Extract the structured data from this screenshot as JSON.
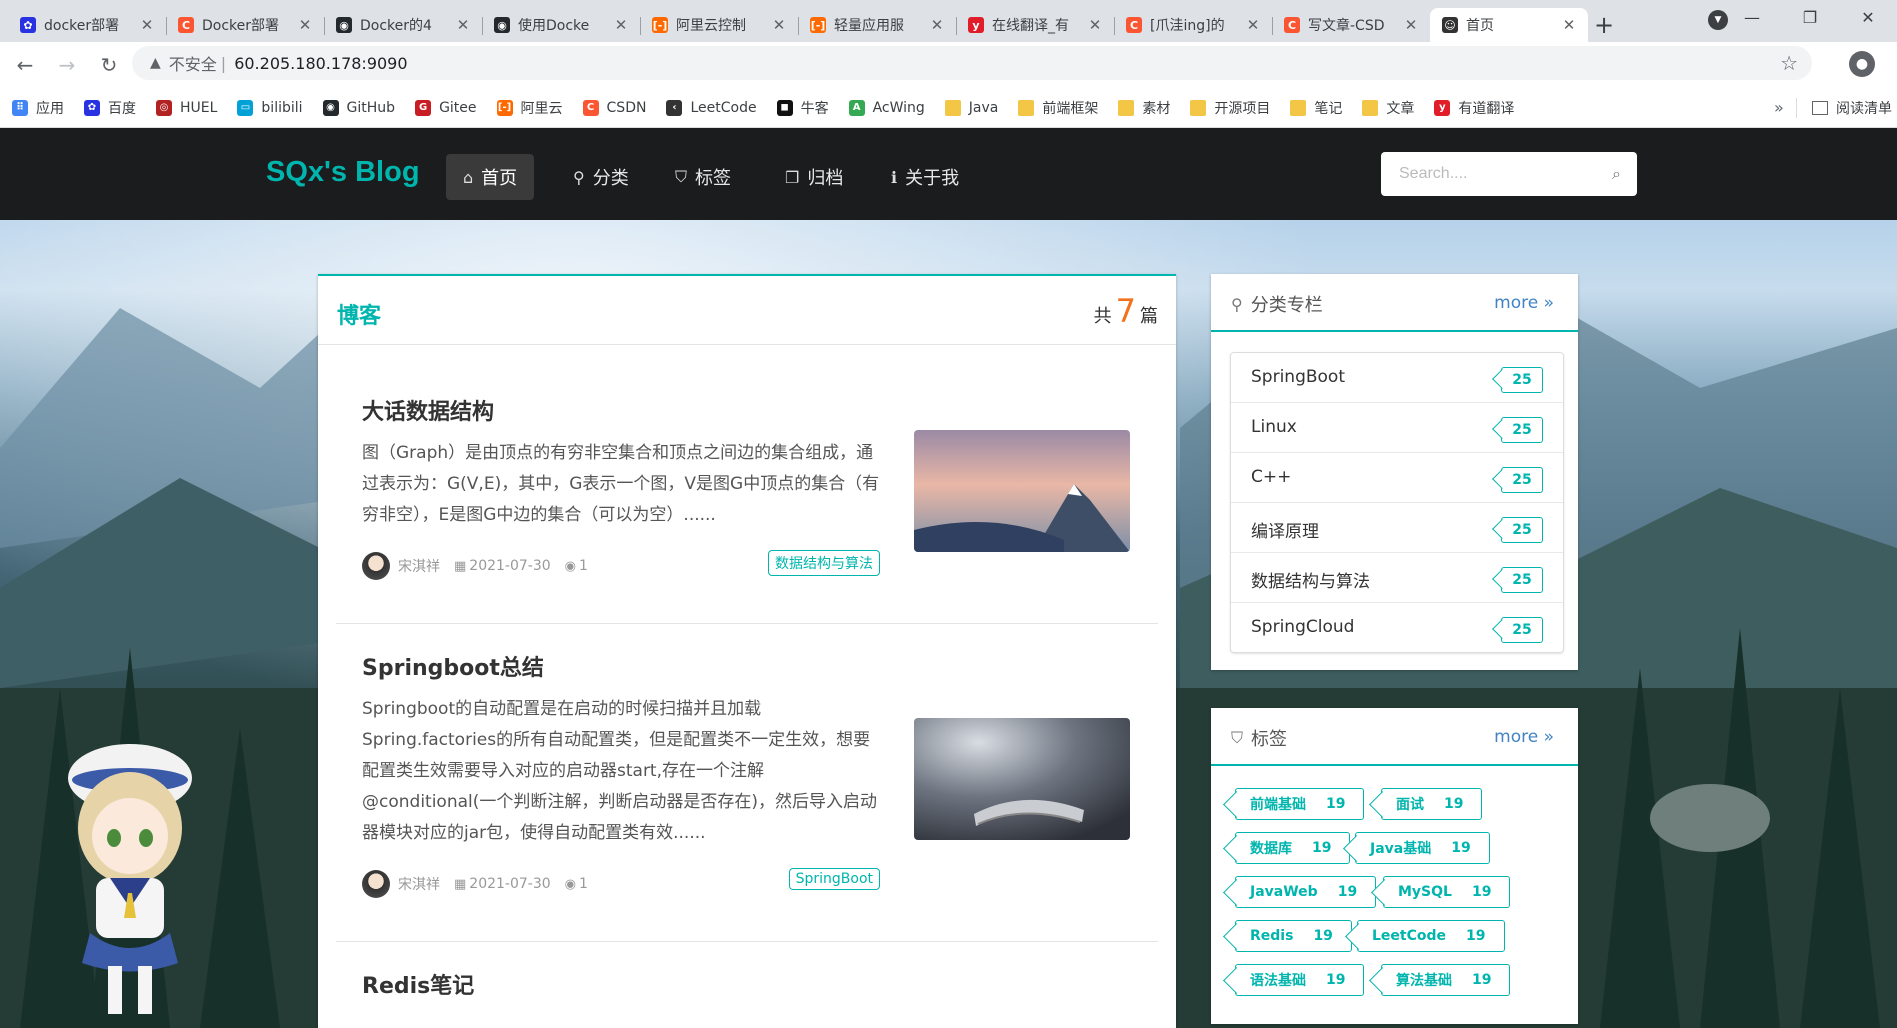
{
  "browser": {
    "tabs": [
      {
        "title": "docker部署",
        "icon": "baidu",
        "color": "#2932e1"
      },
      {
        "title": "Docker部署",
        "icon": "csdn",
        "color": "#fc5531"
      },
      {
        "title": "Docker的4",
        "icon": "github",
        "color": "#24292e"
      },
      {
        "title": "使用Docke",
        "icon": "github",
        "color": "#24292e"
      },
      {
        "title": "阿里云控制",
        "icon": "aliyun",
        "color": "#ff6a00"
      },
      {
        "title": "轻量应用服",
        "icon": "aliyun",
        "color": "#ff6a00"
      },
      {
        "title": "在线翻译_有",
        "icon": "youdao",
        "color": "#e11d2a"
      },
      {
        "title": "[爪洼ing]的",
        "icon": "csdn",
        "color": "#fc5531"
      },
      {
        "title": "写文章-CSD",
        "icon": "csdn",
        "color": "#fc5531"
      },
      {
        "title": "首页",
        "icon": "avatar",
        "color": "#333333"
      }
    ],
    "active_tab": 9,
    "new_tab": "+",
    "address": {
      "warning": "▲",
      "insecure_label": "不安全",
      "separator": "|",
      "url": "60.205.180.178:9090"
    },
    "bookmarks": [
      {
        "label": "应用",
        "icon": "apps",
        "color": "#4285f4"
      },
      {
        "label": "百度",
        "icon": "baidu",
        "color": "#2932e1"
      },
      {
        "label": "HUEL",
        "icon": "huel",
        "color": "#b22222"
      },
      {
        "label": "bilibili",
        "icon": "bilibili",
        "color": "#00a1d6"
      },
      {
        "label": "GitHub",
        "icon": "github",
        "color": "#24292e"
      },
      {
        "label": "Gitee",
        "icon": "gitee",
        "color": "#c71d23"
      },
      {
        "label": "阿里云",
        "icon": "aliyun",
        "color": "#ff6a00"
      },
      {
        "label": "CSDN",
        "icon": "csdn",
        "color": "#fc5531"
      },
      {
        "label": "LeetCode",
        "icon": "leetcode",
        "color": "#333333"
      },
      {
        "label": "牛客",
        "icon": "nowcoder",
        "color": "#111111"
      },
      {
        "label": "AcWing",
        "icon": "acwing",
        "color": "#34a853"
      },
      {
        "label": "Java",
        "icon": "folder",
        "color": "#f4c645"
      },
      {
        "label": "前端框架",
        "icon": "folder",
        "color": "#f4c645"
      },
      {
        "label": "素材",
        "icon": "folder",
        "color": "#f4c645"
      },
      {
        "label": "开源项目",
        "icon": "folder",
        "color": "#f4c645"
      },
      {
        "label": "笔记",
        "icon": "folder",
        "color": "#f4c645"
      },
      {
        "label": "文章",
        "icon": "folder",
        "color": "#f4c645"
      },
      {
        "label": "有道翻译",
        "icon": "youdao",
        "color": "#e11d2a"
      }
    ],
    "more_bookmarks": "»",
    "reading_list": "阅读清单"
  },
  "site": {
    "logo": "SQx's Blog",
    "nav": [
      {
        "label": "首页",
        "icon": "home-icon",
        "glyph": "⌂"
      },
      {
        "label": "分类",
        "icon": "lightbulb-icon",
        "glyph": "⚲"
      },
      {
        "label": "标签",
        "icon": "tags-icon",
        "glyph": "⛉"
      },
      {
        "label": "归档",
        "icon": "clone-icon",
        "glyph": "❐"
      },
      {
        "label": "关于我",
        "icon": "info-icon",
        "glyph": "ℹ"
      }
    ],
    "active_nav": 0,
    "search_placeholder": "Search...."
  },
  "blog": {
    "title": "博客",
    "count_prefix": "共",
    "count": "7",
    "count_suffix": "篇",
    "posts": [
      {
        "title": "大话数据结构",
        "summary": "图（Graph）是由顶点的有穷非空集合和顶点之间边的集合组成，通过表示为：G(V,E)，其中，G表示一个图，V是图G中顶点的集合（有穷非空），E是图G中边的集合（可以为空）......",
        "author": "宋淇祥",
        "date": "2021-07-30",
        "views": "1",
        "tag": "数据结构与算法"
      },
      {
        "title": "Springboot总结",
        "summary": "Springboot的自动配置是在启动的时候扫描并且加载Spring.factories的所有自动配置类，但是配置类不一定生效，想要配置类生效需要导入对应的启动器start,存在一个注解@conditional(一个判断注解，判断启动器是否存在)，然后导入启动器模块对应的jar包，使得自动配置类有效......",
        "author": "宋淇祥",
        "date": "2021-07-30",
        "views": "1",
        "tag": "SpringBoot"
      },
      {
        "title": "Redis笔记",
        "summary": "",
        "author": "",
        "date": "",
        "views": "",
        "tag": ""
      }
    ]
  },
  "sidebar": {
    "categories": {
      "title": "分类专栏",
      "more": "more",
      "items": [
        {
          "name": "SpringBoot",
          "count": "25"
        },
        {
          "name": "Linux",
          "count": "25"
        },
        {
          "name": "C++",
          "count": "25"
        },
        {
          "name": "编译原理",
          "count": "25"
        },
        {
          "name": "数据结构与算法",
          "count": "25"
        },
        {
          "name": "SpringCloud",
          "count": "25"
        }
      ]
    },
    "tags": {
      "title": "标签",
      "more": "more",
      "items": [
        {
          "name": "前端基础",
          "count": "19"
        },
        {
          "name": "面试",
          "count": "19"
        },
        {
          "name": "数据库",
          "count": "19"
        },
        {
          "name": "Java基础",
          "count": "19"
        },
        {
          "name": "JavaWeb",
          "count": "19"
        },
        {
          "name": "MySQL",
          "count": "19"
        },
        {
          "name": "Redis",
          "count": "19"
        },
        {
          "name": "LeetCode",
          "count": "19"
        },
        {
          "name": "语法基础",
          "count": "19"
        },
        {
          "name": "算法基础",
          "count": "19"
        }
      ]
    }
  },
  "colors": {
    "accent": "#00b5ad",
    "count_highlight": "#f2711c",
    "link": "#4183c4",
    "nav_bg": "#1b1c1d"
  }
}
